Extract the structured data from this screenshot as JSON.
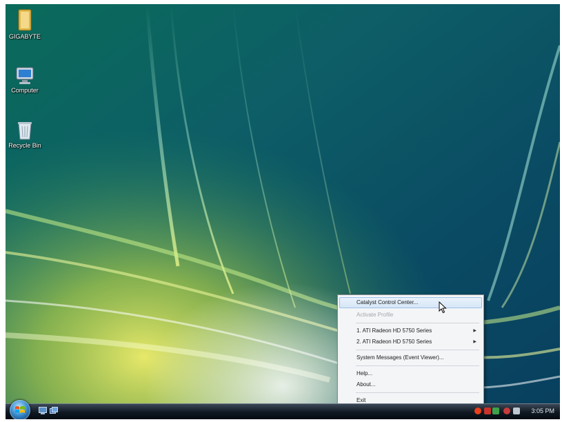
{
  "desktop": {
    "icons": [
      {
        "label": "GIGABYTE",
        "icon": "folder-icon"
      },
      {
        "label": "Computer",
        "icon": "computer-icon"
      },
      {
        "label": "Recycle Bin",
        "icon": "recycle-bin-icon"
      }
    ]
  },
  "context_menu": {
    "items": [
      {
        "label": "Catalyst Control Center...",
        "state": "highlighted"
      },
      {
        "label": "Activate Profile",
        "state": "disabled"
      },
      {
        "label": "1. ATI Radeon HD 5750 Series",
        "submenu": true
      },
      {
        "label": "2. ATI Radeon HD 5750 Series",
        "submenu": true
      },
      {
        "label": "System Messages (Event Viewer)..."
      },
      {
        "label": "Help..."
      },
      {
        "label": "About..."
      },
      {
        "label": "Exit"
      }
    ],
    "submenu_arrow": "▶"
  },
  "taskbar": {
    "clock": "3:05 PM",
    "quick_launch": [
      "show-desktop-icon",
      "switch-windows-icon"
    ],
    "tray_icons": [
      "ati-catalyst-icon",
      "network-icon",
      "shield-icon",
      "power-icon",
      "volume-icon"
    ]
  },
  "colors": {
    "wallpaper_base": "#0c4f5c",
    "wallpaper_glow": "#d9e04a",
    "menu_bg": "#f4f5f7",
    "menu_highlight": "#d6e6f7",
    "taskbar": "#0f1822"
  }
}
